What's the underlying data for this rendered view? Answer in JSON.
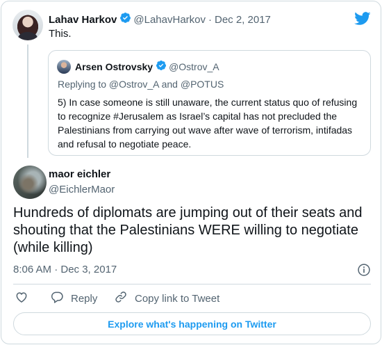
{
  "parent_tweet": {
    "name": "Lahav Harkov",
    "handle": "@LahavHarkov",
    "separator": "·",
    "date": "Dec 2, 2017",
    "text": "This."
  },
  "quoted_tweet": {
    "name": "Arsen Ostrovsky",
    "handle": "@Ostrov_A",
    "replying_to": "Replying to @Ostrov_A and @POTUS",
    "text": "5) In case someone is still unaware, the current status quo of refusing to recognize #Jerusalem as Israel’s capital has not precluded the Palestinians from carrying out wave after wave of terrorism, intifadas and refusal to negotiate peace."
  },
  "main_tweet": {
    "name": "maor eichler",
    "handle": "@EichlerMaor",
    "text": "Hundreds of diplomats are jumping out of their seats and shouting  that the Palestinians WERE willing to negotiate (while killing)",
    "timestamp": "8:06 AM · Dec 3, 2017"
  },
  "actions": {
    "reply_label": "Reply",
    "copy_link_label": "Copy link to Tweet",
    "explore_label": "Explore what's happening on Twitter"
  },
  "colors": {
    "brand_blue": "#1d9bf0",
    "muted_text": "#536471",
    "border": "#cfd9de"
  },
  "icons": [
    "twitter-bird-icon",
    "verified-badge-icon",
    "info-icon",
    "heart-icon",
    "reply-icon",
    "link-icon"
  ]
}
